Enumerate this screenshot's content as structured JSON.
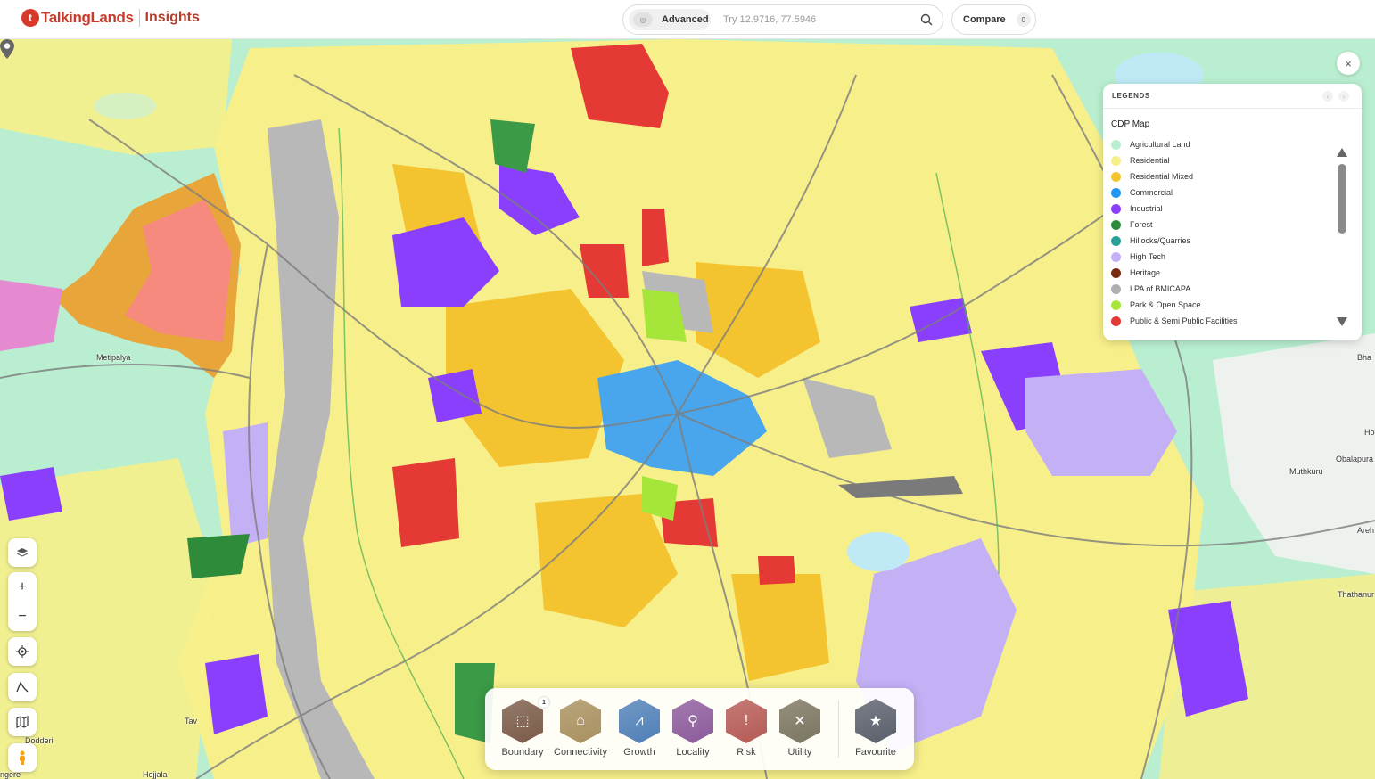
{
  "header": {
    "brand_name": "TalkingLands",
    "product_name": "Insights",
    "search": {
      "mode_label": "Advanced",
      "placeholder": "Try 12.9716, 77.5946"
    },
    "compare": {
      "label": "Compare",
      "count": "0"
    }
  },
  "legend": {
    "title": "LEGENDS",
    "map_title": "CDP Map",
    "items": [
      {
        "label": "Agricultural Land",
        "color": "#b9efd0"
      },
      {
        "label": "Residential",
        "color": "#f7ef8a"
      },
      {
        "label": "Residential Mixed",
        "color": "#f4c430"
      },
      {
        "label": "Commercial",
        "color": "#2196f3"
      },
      {
        "label": "Industrial",
        "color": "#8a3ffc"
      },
      {
        "label": "Forest",
        "color": "#2e8b3a"
      },
      {
        "label": "Hillocks/Quarries",
        "color": "#2aa198"
      },
      {
        "label": "High Tech",
        "color": "#c4b0f5"
      },
      {
        "label": "Heritage",
        "color": "#7b2a12"
      },
      {
        "label": "LPA of BMICAPA",
        "color": "#b0b0b0"
      },
      {
        "label": "Park & Open Space",
        "color": "#a6e63a"
      },
      {
        "label": "Public & Semi Public Facilities",
        "color": "#e53935"
      }
    ]
  },
  "map": {
    "places": [
      "Metipalya",
      "Muthkuru",
      "Obalapura",
      "Thathanur",
      "Areh",
      "Ho",
      "Bha",
      "Dodderi",
      "Hejjala",
      "ngere",
      "Tav"
    ]
  },
  "toolbar": {
    "items": [
      {
        "label": "Boundary",
        "color": "#7a5a48",
        "badge": "1"
      },
      {
        "label": "Connectivity",
        "color": "#a8905f"
      },
      {
        "label": "Growth",
        "color": "#4f7fb8"
      },
      {
        "label": "Locality",
        "color": "#8b5a9b"
      },
      {
        "label": "Risk",
        "color": "#b55a55"
      },
      {
        "label": "Utility",
        "color": "#7a7560"
      },
      {
        "label": "Favourite",
        "color": "#5a5f6b"
      }
    ]
  }
}
